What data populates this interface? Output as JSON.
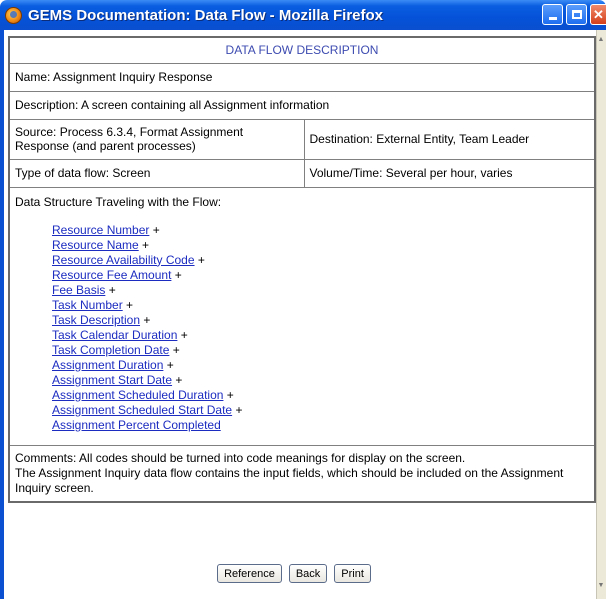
{
  "window": {
    "title": "GEMS Documentation: Data Flow - Mozilla Firefox"
  },
  "doc": {
    "heading": "DATA FLOW DESCRIPTION",
    "name": "Name: Assignment Inquiry Response",
    "description": "Description: A screen containing all Assignment information",
    "source": "Source: Process 6.3.4, Format Assignment Response (and parent processes)",
    "destination": "Destination: External Entity, Team Leader",
    "flow_type": "Type of data flow: Screen",
    "volume_time": "Volume/Time: Several per hour, varies",
    "structure_label": "Data Structure Traveling with the Flow:",
    "structure_items": [
      {
        "label": "Resource Number",
        "suffix": " +"
      },
      {
        "label": "Resource Name",
        "suffix": " +"
      },
      {
        "label": "Resource Availability Code",
        "suffix": " +"
      },
      {
        "label": "Resource Fee Amount",
        "suffix": " +"
      },
      {
        "label": "Fee Basis",
        "suffix": " +"
      },
      {
        "label": "Task Number",
        "suffix": " +"
      },
      {
        "label": "Task Description",
        "suffix": " +"
      },
      {
        "label": "Task Calendar Duration",
        "suffix": " +"
      },
      {
        "label": "Task Completion Date",
        "suffix": " +"
      },
      {
        "label": "Assignment Duration",
        "suffix": " +"
      },
      {
        "label": "Assignment Start Date",
        "suffix": " +"
      },
      {
        "label": "Assignment Scheduled Duration",
        "suffix": " +"
      },
      {
        "label": "Assignment Scheduled Start Date",
        "suffix": " +"
      },
      {
        "label": "Assignment Percent Completed",
        "suffix": ""
      }
    ],
    "comments_line1": "Comments: All codes should be turned into code meanings for display on the screen.",
    "comments_line2": "The Assignment Inquiry data flow contains the input fields, which should be included on the Assignment Inquiry screen."
  },
  "buttons": {
    "reference": "Reference",
    "back": "Back",
    "print": "Print"
  },
  "colors": {
    "title_bar": "#0552d8",
    "link": "#1c2cc0",
    "heading": "#3d4bb0"
  }
}
